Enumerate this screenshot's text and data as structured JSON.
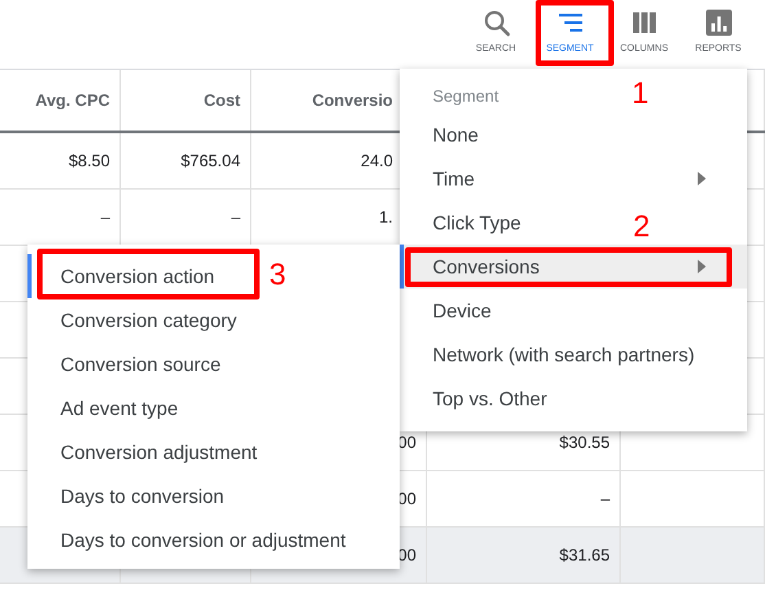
{
  "toolbar": [
    {
      "kind": "search",
      "label": "SEARCH",
      "selected": false
    },
    {
      "kind": "segment",
      "label": "SEGMENT",
      "selected": true,
      "annotation": "1"
    },
    {
      "kind": "columns",
      "label": "COLUMNS",
      "selected": false
    },
    {
      "kind": "reports",
      "label": "REPORTS",
      "selected": false
    }
  ],
  "table": {
    "columns": [
      "Avg. CPC",
      "Cost",
      "Conversio",
      "",
      ""
    ],
    "rows": [
      {
        "cells": [
          "$8.50",
          "$765.04",
          "24.0",
          "",
          ""
        ],
        "highlighted": false
      },
      {
        "cells": [
          "–",
          "–",
          "1.",
          "",
          ""
        ],
        "highlighted": false
      },
      {
        "cells": [
          "",
          "",
          "",
          "",
          ""
        ],
        "highlighted": false
      },
      {
        "cells": [
          "",
          "",
          "",
          "",
          ""
        ],
        "highlighted": false
      },
      {
        "cells": [
          "",
          "",
          "",
          "",
          ""
        ],
        "highlighted": false
      },
      {
        "cells": [
          "",
          "",
          "00",
          "$30.55",
          ""
        ],
        "highlighted": false
      },
      {
        "cells": [
          "",
          "",
          "00",
          "–",
          ""
        ],
        "highlighted": false
      },
      {
        "cells": [
          "",
          "",
          "00",
          "$31.65",
          ""
        ],
        "highlighted": true
      }
    ]
  },
  "segment_menu": {
    "title": "Segment",
    "items": [
      {
        "label": "None",
        "submenu": false,
        "selected": false
      },
      {
        "label": "Time",
        "submenu": true,
        "selected": false
      },
      {
        "label": "Click Type",
        "submenu": false,
        "selected": false
      },
      {
        "label": "Conversions",
        "submenu": true,
        "selected": true,
        "annotation": "2"
      },
      {
        "label": "Device",
        "submenu": false,
        "selected": false
      },
      {
        "label": "Network (with search partners)",
        "submenu": false,
        "selected": false
      },
      {
        "label": "Top vs. Other",
        "submenu": false,
        "selected": false
      }
    ]
  },
  "conversions_submenu": {
    "items": [
      {
        "label": "Conversion action",
        "selected": true,
        "annotation": "3"
      },
      {
        "label": "Conversion category",
        "selected": false
      },
      {
        "label": "Conversion source",
        "selected": false
      },
      {
        "label": "Ad event type",
        "selected": false
      },
      {
        "label": "Conversion adjustment",
        "selected": false
      },
      {
        "label": "Days to conversion",
        "selected": false
      },
      {
        "label": "Days to conversion or adjustment",
        "selected": false
      }
    ]
  }
}
